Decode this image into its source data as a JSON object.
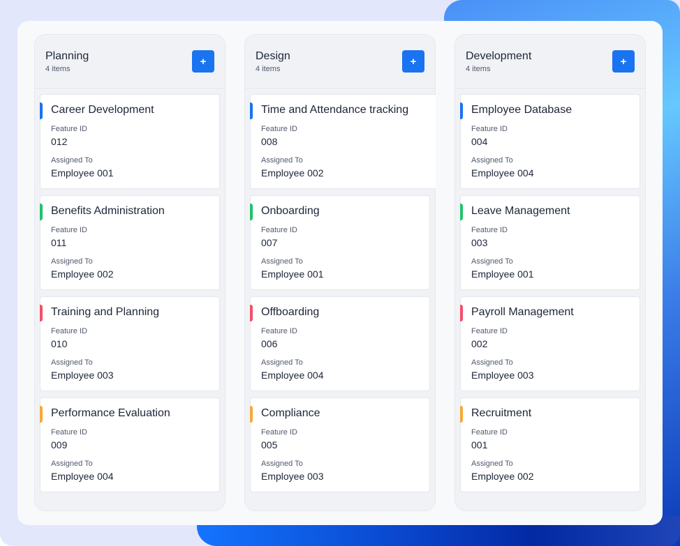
{
  "board": {
    "labels": {
      "feature_id": "Feature ID",
      "assigned_to": "Assigned To",
      "add_icon": "+"
    },
    "accent_colors": {
      "blue": "#1a73f0",
      "green": "#22c26b",
      "red": "#f2506a",
      "orange": "#f5a93a"
    },
    "columns": [
      {
        "title": "Planning",
        "count": "4 items",
        "cards": [
          {
            "title": "Career Development",
            "feature_id": "012",
            "assigned_to": "Employee 001",
            "accent": "#1a73f0"
          },
          {
            "title": "Benefits Administration",
            "feature_id": "011",
            "assigned_to": "Employee 002",
            "accent": "#22c26b"
          },
          {
            "title": "Training and Planning",
            "feature_id": "010",
            "assigned_to": "Employee 003",
            "accent": "#f2506a"
          },
          {
            "title": "Performance Evaluation",
            "feature_id": "009",
            "assigned_to": "Employee 004",
            "accent": "#f5a93a"
          }
        ]
      },
      {
        "title": "Design",
        "count": "4 items",
        "cards": [
          {
            "title": "Time and Attendance tracking",
            "feature_id": "008",
            "assigned_to": "Employee 002",
            "accent": "#1a73f0"
          },
          {
            "title": "Onboarding",
            "feature_id": "007",
            "assigned_to": "Employee 001",
            "accent": "#22c26b"
          },
          {
            "title": "Offboarding",
            "feature_id": "006",
            "assigned_to": "Employee 004",
            "accent": "#f2506a"
          },
          {
            "title": "Compliance",
            "feature_id": "005",
            "assigned_to": "Employee 003",
            "accent": "#f5a93a"
          }
        ]
      },
      {
        "title": "Development",
        "count": "4 items",
        "cards": [
          {
            "title": "Employee Database",
            "feature_id": "004",
            "assigned_to": "Employee 004",
            "accent": "#1a73f0"
          },
          {
            "title": "Leave Management",
            "feature_id": "003",
            "assigned_to": "Employee 001",
            "accent": "#22c26b"
          },
          {
            "title": "Payroll Management",
            "feature_id": "002",
            "assigned_to": "Employee 003",
            "accent": "#f2506a"
          },
          {
            "title": "Recruitment",
            "feature_id": "001",
            "assigned_to": "Employee 002",
            "accent": "#f5a93a"
          }
        ]
      }
    ]
  }
}
